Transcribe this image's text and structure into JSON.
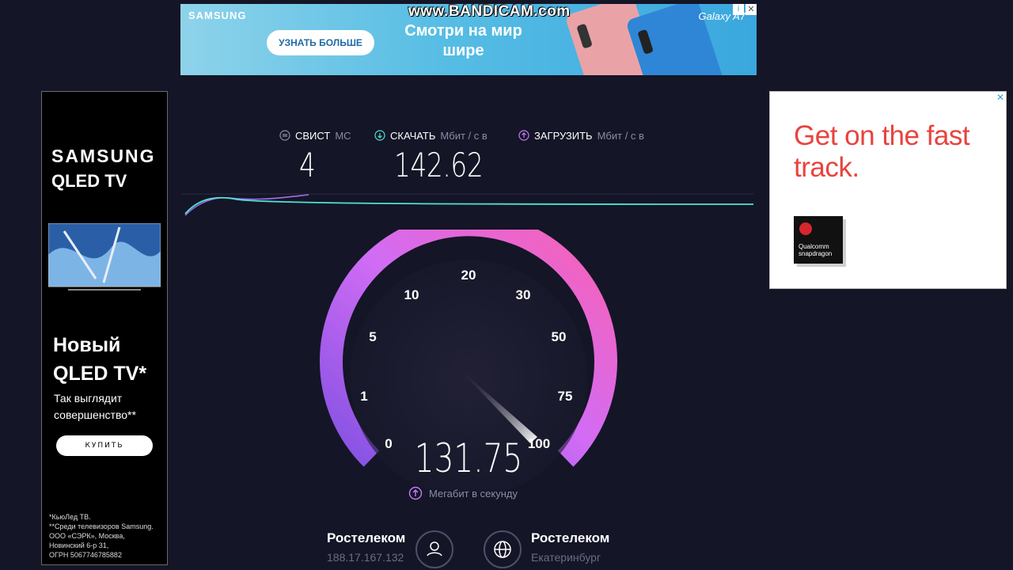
{
  "top_ad": {
    "brand": "SAMSUNG",
    "cta": "УЗНАТЬ БОЛЬШЕ",
    "tagline": "Смотри на мир шире",
    "model": "Galaxy A7",
    "colors": {
      "background": "#57bde4"
    }
  },
  "watermark": "www.BANDICAM.com",
  "left_ad": {
    "brand": "SAMSUNG",
    "product": "QLED TV",
    "headline": "Новый QLED TV*",
    "sub": "Так выглядит совершенство**",
    "button": "КУПИТЬ",
    "fine_print": "*КьюЛед ТВ.\n**Среди телевизоров Samsung.\nООО «СЭРК», Москва,\nНовинский 6-р 31,\nОГРН 5067746785882"
  },
  "right_ad": {
    "headline": "Get on the fast track.",
    "logo": "Qualcomm snapdragon",
    "colors": {
      "headline": "#e8433f"
    }
  },
  "stats": {
    "ping": {
      "label": "СВИСТ",
      "unit": "МС",
      "value": "4"
    },
    "download": {
      "label": "СКАЧАТЬ",
      "unit": "Мбит / с в",
      "value": "142.62"
    },
    "upload": {
      "label": "ЗАГРУЗИТЬ",
      "unit": "Мбит / с в",
      "value": ""
    }
  },
  "gauge": {
    "ticks": [
      "0",
      "1",
      "5",
      "10",
      "20",
      "30",
      "50",
      "75",
      "100"
    ],
    "speed": "131.75",
    "unit": "Мегабит в секунду",
    "colors": {
      "start": "#7b4fe0",
      "mid": "#d26cf5",
      "end": "#ff5fa8"
    }
  },
  "client": {
    "isp": "Ростелеком",
    "ip": "188.17.167.132"
  },
  "server": {
    "isp": "Ростелеком",
    "city": "Екатеринбург"
  }
}
